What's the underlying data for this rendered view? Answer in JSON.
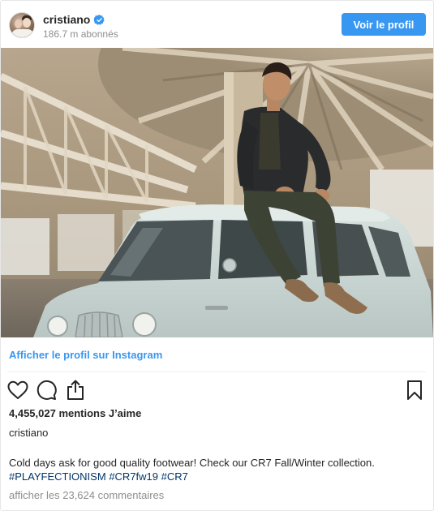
{
  "header": {
    "username": "cristiano",
    "followers": "186.7 m abonnés",
    "view_profile_label": "Voir le profil",
    "verified_icon": "verified-badge-icon",
    "accent_color": "#3897f0"
  },
  "photo": {
    "alt_icon": "post-photo"
  },
  "link": {
    "view_on_instagram": "Afficher le profil sur Instagram"
  },
  "actions": {
    "like_icon": "heart-icon",
    "comment_icon": "comment-icon",
    "share_icon": "share-icon",
    "save_icon": "bookmark-icon"
  },
  "post": {
    "likes": "4,455,027 mentions J’aime",
    "owner": "cristiano",
    "caption_text": "Cold days ask for good quality footwear! Check our CR7 Fall/Winter collection.",
    "hashtags": [
      "#PLAYFECTIONISM",
      "#CR7fw19",
      "#CR7"
    ],
    "comments_link": "afficher les 23,624 commentaires"
  }
}
